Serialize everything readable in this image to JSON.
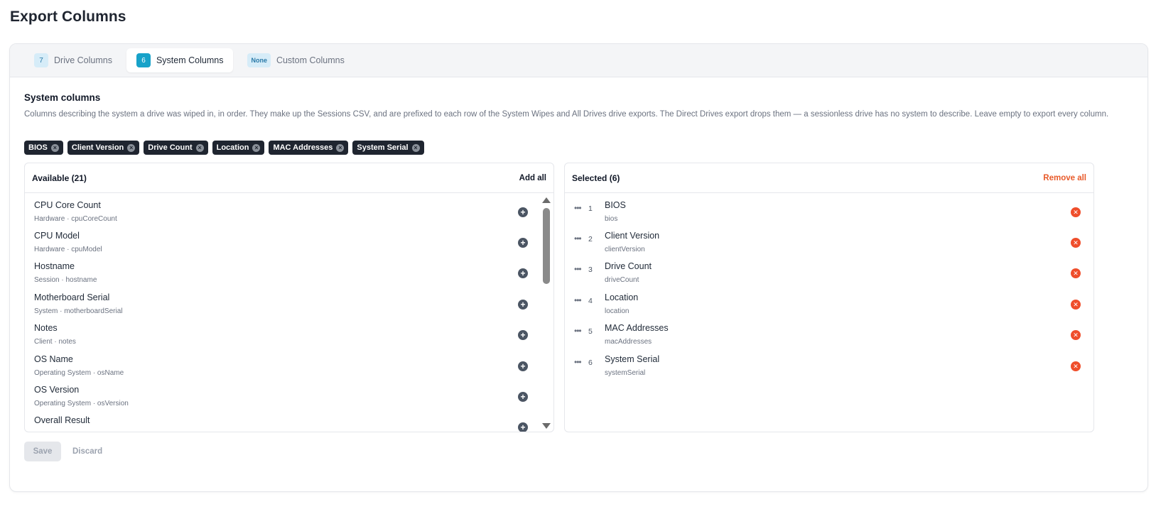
{
  "page": {
    "title": "Export Columns"
  },
  "tabs": [
    {
      "count": "7",
      "label": "Drive Columns"
    },
    {
      "count": "6",
      "label": "System Columns"
    },
    {
      "count": "None",
      "label": "Custom Columns"
    }
  ],
  "section": {
    "title": "System columns",
    "description": "Columns describing the system a drive was wiped in, in order. They make up the Sessions CSV, and are prefixed to each row of the System Wipes and All Drives drive exports. The Direct Drives export drops them — a sessionless drive has no system to describe. Leave empty to export every column."
  },
  "chips": [
    "BIOS",
    "Client Version",
    "Drive Count",
    "Location",
    "MAC Addresses",
    "System Serial"
  ],
  "available": {
    "title": "Available (21)",
    "action": "Add all",
    "items": [
      {
        "name": "CPU Core Count",
        "meta": "Hardware · cpuCoreCount"
      },
      {
        "name": "CPU Model",
        "meta": "Hardware · cpuModel"
      },
      {
        "name": "Hostname",
        "meta": "Session · hostname"
      },
      {
        "name": "Motherboard Serial",
        "meta": "System · motherboardSerial"
      },
      {
        "name": "Notes",
        "meta": "Client · notes"
      },
      {
        "name": "OS Name",
        "meta": "Operating System · osName"
      },
      {
        "name": "OS Version",
        "meta": "Operating System · osVersion"
      },
      {
        "name": "Overall Result",
        "meta": ""
      }
    ]
  },
  "selected": {
    "title": "Selected (6)",
    "action": "Remove all",
    "items": [
      {
        "index": "1",
        "name": "BIOS",
        "meta": "bios"
      },
      {
        "index": "2",
        "name": "Client Version",
        "meta": "clientVersion"
      },
      {
        "index": "3",
        "name": "Drive Count",
        "meta": "driveCount"
      },
      {
        "index": "4",
        "name": "Location",
        "meta": "location"
      },
      {
        "index": "5",
        "name": "MAC Addresses",
        "meta": "macAddresses"
      },
      {
        "index": "6",
        "name": "System Serial",
        "meta": "systemSerial"
      }
    ]
  },
  "footer": {
    "save": "Save",
    "discard": "Discard"
  },
  "icons": {
    "drag": "drag-handle-icon",
    "add": "plus-circle-icon",
    "remove": "x-circle-icon",
    "chip_remove": "x-icon"
  },
  "colors": {
    "accent": "#17a2c9",
    "danger": "#ef4e2b",
    "chip_bg": "#1f2530"
  }
}
